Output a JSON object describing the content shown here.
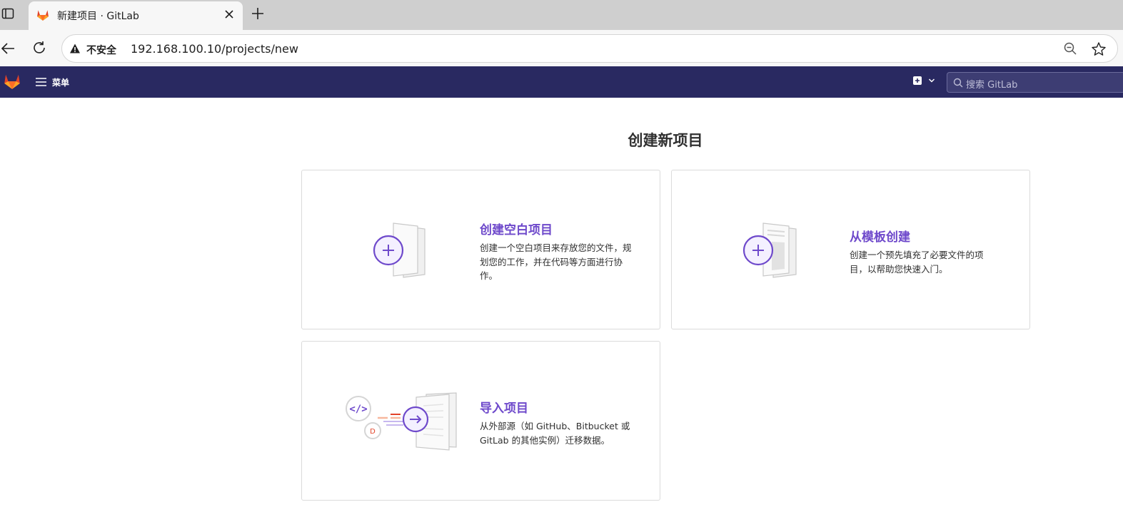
{
  "browser": {
    "tab_title": "新建项目 · GitLab",
    "security_label": "不安全",
    "url": "192.168.100.10/projects/new"
  },
  "header": {
    "menu_label": "菜单",
    "search_placeholder": "搜索 GitLab"
  },
  "main": {
    "page_title": "创建新项目",
    "cards": [
      {
        "title": "创建空白项目",
        "description": "创建一个空白项目来存放您的文件，规划您的工作，并在代码等方面进行协作。"
      },
      {
        "title": "从模板创建",
        "description": "创建一个预先填充了必要文件的项目，以帮助您快速入门。"
      },
      {
        "title": "导入项目",
        "description": "从外部源（如 GitHub、Bitbucket 或 GitLab 的其他实例）迁移数据。"
      }
    ]
  },
  "colors": {
    "header_bg": "#292961",
    "accent": "#6e49cb",
    "gitlab_orange": "#e24329"
  }
}
